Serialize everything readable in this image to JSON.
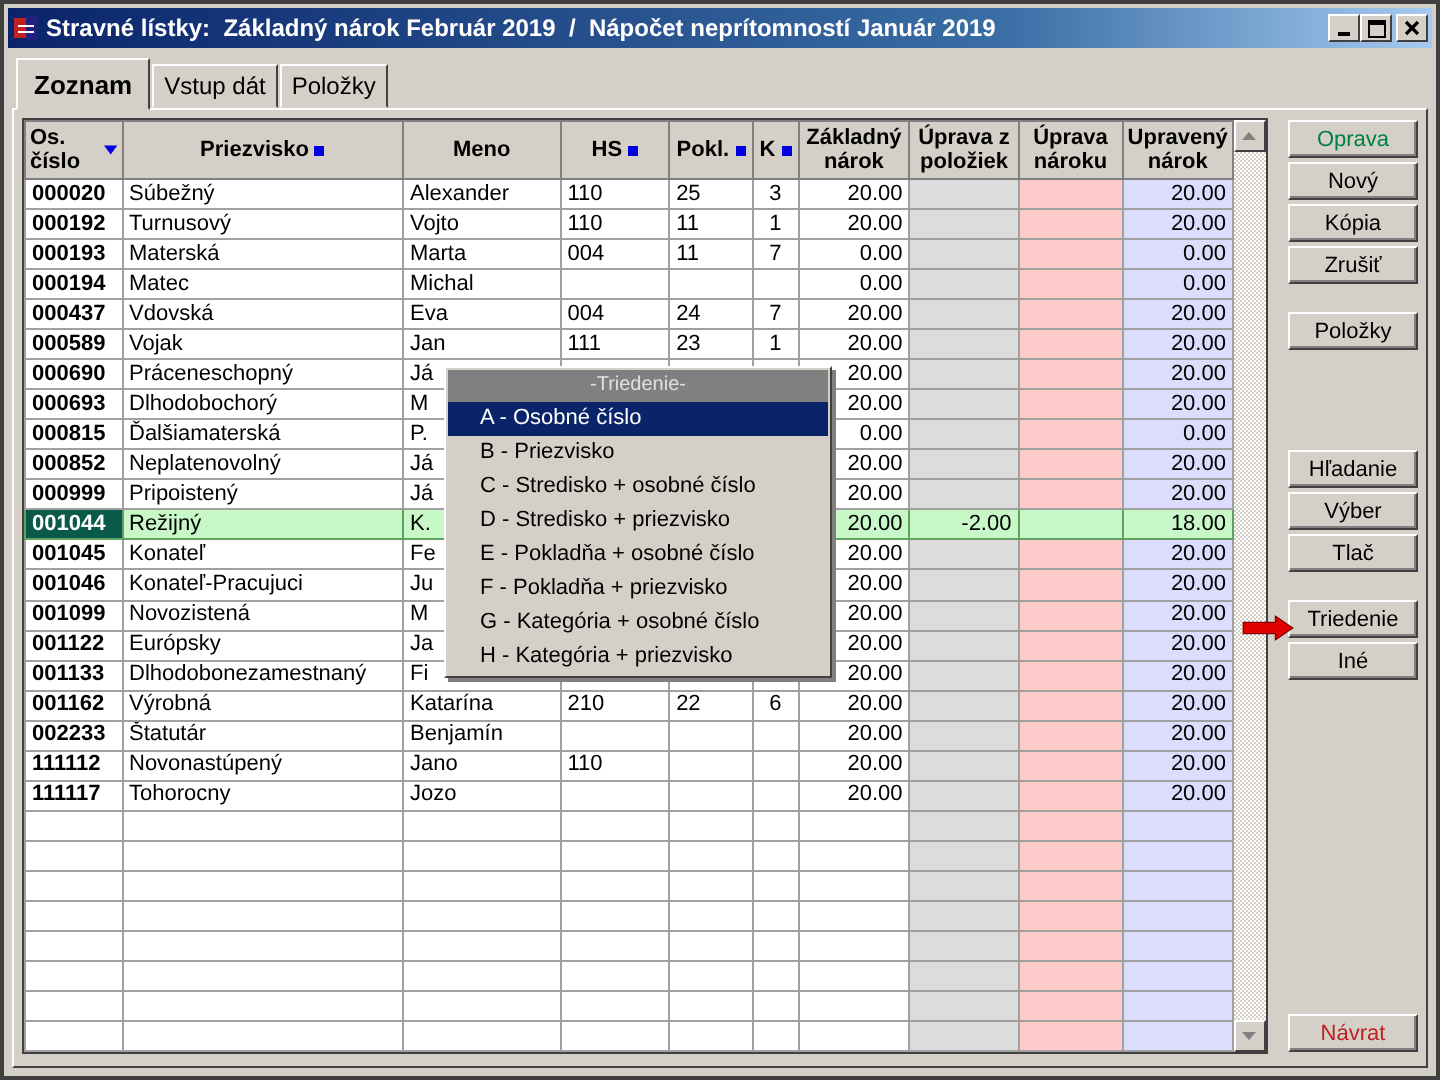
{
  "window": {
    "title": "Stravné lístky:  Základný nárok Február 2019  /  Nápočet neprítomností Január 2019"
  },
  "tabs": [
    {
      "label": "Zoznam",
      "selected": true
    },
    {
      "label": "Vstup dát",
      "selected": false
    },
    {
      "label": "Položky",
      "selected": false
    }
  ],
  "table": {
    "columns": [
      {
        "label": "Os. číslo",
        "kind": "id",
        "sorted": true,
        "indexed": false
      },
      {
        "label": "Priezvisko",
        "kind": "text",
        "sorted": false,
        "indexed": true
      },
      {
        "label": "Meno",
        "kind": "text",
        "sorted": false,
        "indexed": false
      },
      {
        "label": "HS",
        "kind": "text",
        "sorted": false,
        "indexed": true
      },
      {
        "label": "Pokl.",
        "kind": "text",
        "sorted": false,
        "indexed": true
      },
      {
        "label": "K",
        "kind": "center",
        "sorted": false,
        "indexed": true
      },
      {
        "label": "Základný nárok",
        "kind": "number",
        "sorted": false,
        "indexed": false
      },
      {
        "label": "Úprava z položiek",
        "kind": "adjust",
        "sorted": false,
        "indexed": false
      },
      {
        "label": "Úprava nároku",
        "kind": "claim",
        "sorted": false,
        "indexed": false
      },
      {
        "label": "Upravený nárok",
        "kind": "result",
        "sorted": false,
        "indexed": false
      }
    ],
    "rows": [
      {
        "cells": [
          "000020",
          "Súbežný",
          "Alexander",
          "110",
          "25",
          "3",
          "20.00",
          null,
          null,
          "20.00"
        ],
        "selected": false
      },
      {
        "cells": [
          "000192",
          "Turnusový",
          "Vojto",
          "110",
          "11",
          "1",
          "20.00",
          null,
          null,
          "20.00"
        ],
        "selected": false
      },
      {
        "cells": [
          "000193",
          "Materská",
          "Marta",
          "004",
          "11",
          "7",
          "0.00",
          null,
          null,
          "0.00"
        ],
        "selected": false
      },
      {
        "cells": [
          "000194",
          "Matec",
          "Michal",
          null,
          null,
          null,
          "0.00",
          null,
          null,
          "0.00"
        ],
        "selected": false
      },
      {
        "cells": [
          "000437",
          "Vdovská",
          "Eva",
          "004",
          "24",
          "7",
          "20.00",
          null,
          null,
          "20.00"
        ],
        "selected": false
      },
      {
        "cells": [
          "000589",
          "Vojak",
          "Jan",
          "111",
          "23",
          "1",
          "20.00",
          null,
          null,
          "20.00"
        ],
        "selected": false
      },
      {
        "cells": [
          "000690",
          "Práceneschopný",
          "Já",
          null,
          null,
          null,
          "20.00",
          null,
          null,
          "20.00"
        ],
        "selected": false
      },
      {
        "cells": [
          "000693",
          "Dlhodobochorý",
          "M",
          null,
          null,
          null,
          "20.00",
          null,
          null,
          "20.00"
        ],
        "selected": false
      },
      {
        "cells": [
          "000815",
          "Ďalšiamaterská",
          "P.",
          null,
          null,
          null,
          "0.00",
          null,
          null,
          "0.00"
        ],
        "selected": false
      },
      {
        "cells": [
          "000852",
          "Neplatenovolný",
          "Já",
          null,
          null,
          null,
          "20.00",
          null,
          null,
          "20.00"
        ],
        "selected": false
      },
      {
        "cells": [
          "000999",
          "Pripoistený",
          "Já",
          null,
          null,
          null,
          "20.00",
          null,
          null,
          "20.00"
        ],
        "selected": false
      },
      {
        "cells": [
          "001044",
          "Režijný",
          "K.",
          null,
          null,
          null,
          "20.00",
          "-2.00",
          null,
          "18.00"
        ],
        "selected": true
      },
      {
        "cells": [
          "001045",
          "Konateľ",
          "Fe",
          null,
          null,
          null,
          "20.00",
          null,
          null,
          "20.00"
        ],
        "selected": false
      },
      {
        "cells": [
          "001046",
          "Konateľ-Pracujuci",
          "Ju",
          null,
          null,
          null,
          "20.00",
          null,
          null,
          "20.00"
        ],
        "selected": false
      },
      {
        "cells": [
          "001099",
          "Novozistená",
          "M",
          null,
          null,
          null,
          "20.00",
          null,
          null,
          "20.00"
        ],
        "selected": false
      },
      {
        "cells": [
          "001122",
          "Európsky",
          "Ja",
          null,
          null,
          null,
          "20.00",
          null,
          null,
          "20.00"
        ],
        "selected": false
      },
      {
        "cells": [
          "001133",
          "Dlhodobonezamestnaný",
          "Fi",
          null,
          null,
          null,
          "20.00",
          null,
          null,
          "20.00"
        ],
        "selected": false
      },
      {
        "cells": [
          "001162",
          "Výrobná",
          "Katarína",
          "210",
          "22",
          "6",
          "20.00",
          null,
          null,
          "20.00"
        ],
        "selected": false
      },
      {
        "cells": [
          "002233",
          "Štatutár",
          "Benjamín",
          null,
          null,
          null,
          "20.00",
          null,
          null,
          "20.00"
        ],
        "selected": false
      },
      {
        "cells": [
          "111112",
          "Novonastúpený",
          "Jano",
          "110",
          null,
          null,
          "20.00",
          null,
          null,
          "20.00"
        ],
        "selected": false
      },
      {
        "cells": [
          "111117",
          "Tohorocny",
          "Jozo",
          null,
          null,
          null,
          "20.00",
          null,
          null,
          "20.00"
        ],
        "selected": false
      }
    ]
  },
  "sort_menu": {
    "title": "-Triedenie-",
    "items": [
      {
        "label": "A - Osobné číslo",
        "selected": true
      },
      {
        "label": "B - Priezvisko",
        "selected": false
      },
      {
        "label": "C - Stredisko + osobné číslo",
        "selected": false
      },
      {
        "label": "D - Stredisko + priezvisko",
        "selected": false
      },
      {
        "label": "E - Pokladňa + osobné číslo",
        "selected": false
      },
      {
        "label": "F - Pokladňa + priezvisko",
        "selected": false
      },
      {
        "label": "G - Kategória + osobné číslo",
        "selected": false
      },
      {
        "label": "H - Kategória + priezvisko",
        "selected": false
      }
    ]
  },
  "button_groups": [
    [
      {
        "label": "Oprava",
        "color": "#008040"
      },
      {
        "label": "Nový"
      },
      {
        "label": "Kópia"
      },
      {
        "label": "Zrušiť"
      }
    ],
    [
      {
        "label": "Položky"
      }
    ],
    [
      {
        "label": "Hľadanie"
      },
      {
        "label": "Výber"
      },
      {
        "label": "Tlač"
      }
    ],
    [
      {
        "label": "Triedenie"
      },
      {
        "label": "Iné"
      }
    ],
    [
      {
        "label": "Návrat",
        "color": "#c02020"
      }
    ]
  ]
}
